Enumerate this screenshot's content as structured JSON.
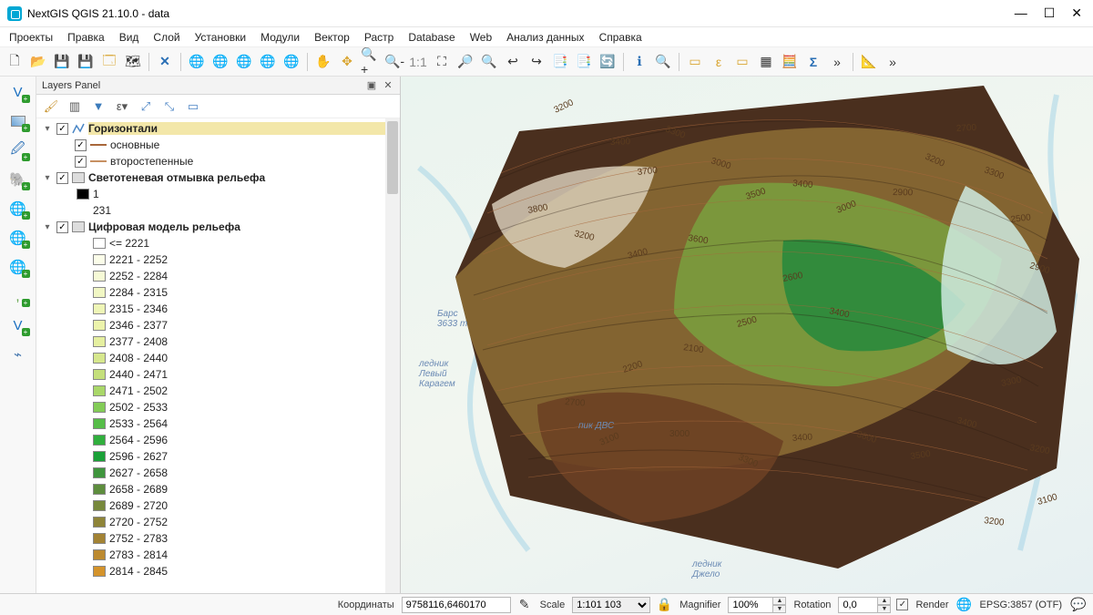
{
  "title": "NextGIS QGIS 21.10.0 - data",
  "menu": [
    "Проекты",
    "Правка",
    "Вид",
    "Слой",
    "Установки",
    "Модули",
    "Вектор",
    "Растр",
    "Database",
    "Web",
    "Анализ данных",
    "Справка"
  ],
  "panel": {
    "title": "Layers Panel"
  },
  "layers": {
    "l0": {
      "name": "Горизонтали",
      "sub0": "основные",
      "sub1": "второстепенные"
    },
    "l1": {
      "name": "Светотеневая отмывка рельефа",
      "v1": "1",
      "v2": "231"
    },
    "l2": {
      "name": "Цифровая модель рельефа"
    }
  },
  "classes": [
    {
      "label": "<= 2221",
      "color": "#ffffff"
    },
    {
      "label": "2221 - 2252",
      "color": "#fbfde9"
    },
    {
      "label": "2252 - 2284",
      "color": "#f6fad6"
    },
    {
      "label": "2284 - 2315",
      "color": "#f1f7c4"
    },
    {
      "label": "2315 - 2346",
      "color": "#eef5b6"
    },
    {
      "label": "2346 - 2377",
      "color": "#ecf3ab"
    },
    {
      "label": "2377 - 2408",
      "color": "#e5efa0"
    },
    {
      "label": "2408 - 2440",
      "color": "#d6e78d"
    },
    {
      "label": "2440 - 2471",
      "color": "#c4df7b"
    },
    {
      "label": "2471 - 2502",
      "color": "#a9d769"
    },
    {
      "label": "2502 - 2533",
      "color": "#83cc57"
    },
    {
      "label": "2533 - 2564",
      "color": "#56bd48"
    },
    {
      "label": "2564 - 2596",
      "color": "#30af3d"
    },
    {
      "label": "2596 - 2627",
      "color": "#1aa138"
    },
    {
      "label": "2627 - 2658",
      "color": "#3f953d"
    },
    {
      "label": "2658 - 2689",
      "color": "#5d8d3d"
    },
    {
      "label": "2689 - 2720",
      "color": "#77883c"
    },
    {
      "label": "2720 - 2752",
      "color": "#8e8438"
    },
    {
      "label": "2752 - 2783",
      "color": "#a38334"
    },
    {
      "label": "2783 - 2814",
      "color": "#bc8a30"
    },
    {
      "label": "2814 - 2845",
      "color": "#d4932b"
    }
  ],
  "map_labels": {
    "a": "ледник\nЛевый\nКарагем",
    "b": "ледник\nДжело",
    "c": "пик ДВС",
    "d": "Барс\n3633 m"
  },
  "status": {
    "coords_label": "Координаты",
    "coords_value": "9758116,6460170",
    "scale_label": "Scale",
    "scale_value": "1:101 103",
    "mag_label": "Magnifier",
    "mag_value": "100%",
    "rot_label": "Rotation",
    "rot_value": "0,0",
    "render_label": "Render",
    "crs": "EPSG:3857 (OTF)"
  },
  "contour_values": [
    "3200",
    "3400",
    "3300",
    "3700",
    "3000",
    "3800",
    "3200",
    "3400",
    "3600",
    "3500",
    "3400",
    "3000",
    "2900",
    "3200",
    "2700",
    "3300",
    "2500",
    "2900",
    "2600",
    "3400",
    "2500",
    "2100",
    "2200",
    "2700",
    "3100",
    "3000",
    "3300",
    "3400",
    "3600",
    "3500",
    "3400",
    "3300",
    "3200",
    "3100",
    "3200"
  ]
}
